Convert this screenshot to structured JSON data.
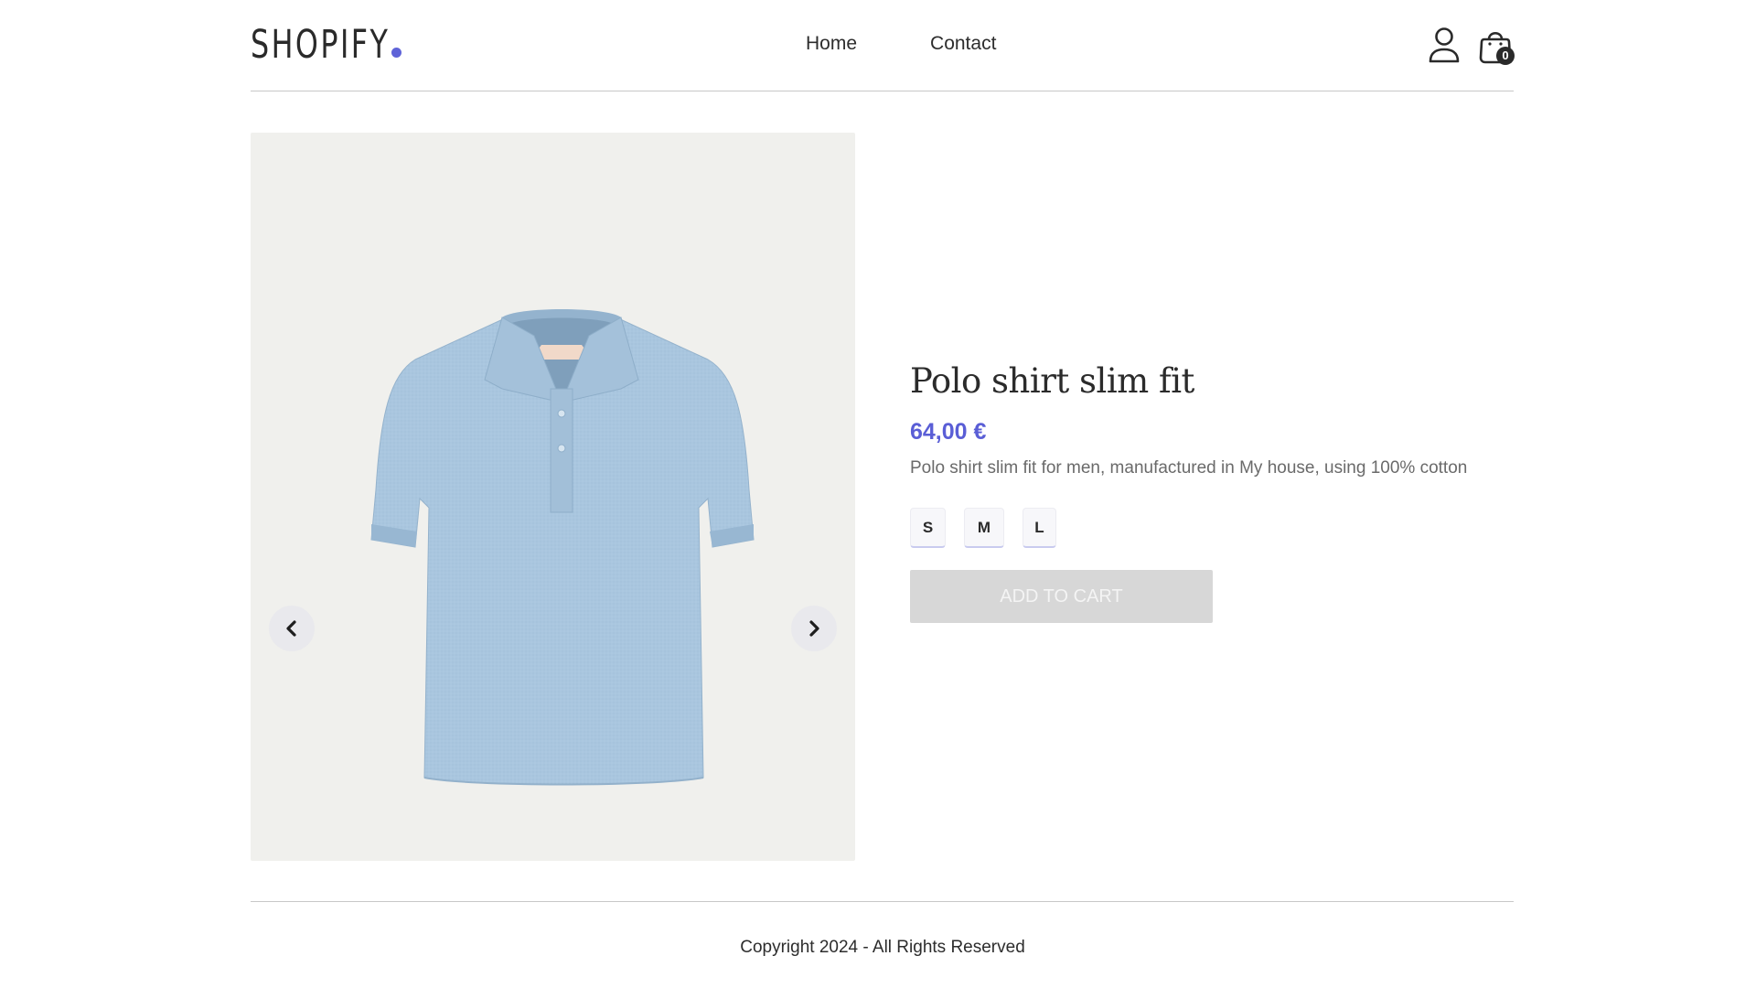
{
  "header": {
    "logo_text": "SHOPIFY",
    "nav": [
      {
        "label": "Home"
      },
      {
        "label": "Contact"
      }
    ],
    "cart_count": "0"
  },
  "product": {
    "title": "Polo shirt slim fit",
    "price": "64,00 €",
    "description": "Polo shirt slim fit for men, manufactured in My house, using 100% cotton",
    "sizes": [
      "S",
      "M",
      "L"
    ],
    "add_to_cart_label": "ADD TO CART",
    "image_alt": "Light blue polo shirt"
  },
  "footer": {
    "copyright": "Copyright 2024 - All Rights Reserved"
  },
  "colors": {
    "accent": "#5a5ed6",
    "text": "#2d2d2d",
    "image_bg": "#f0f0ed",
    "shirt": "#a9c6df",
    "button_disabled": "#d7d7d7"
  },
  "icons": {
    "user": "user-icon",
    "cart": "shopping-bag-icon",
    "prev": "chevron-left-icon",
    "next": "chevron-right-icon"
  }
}
